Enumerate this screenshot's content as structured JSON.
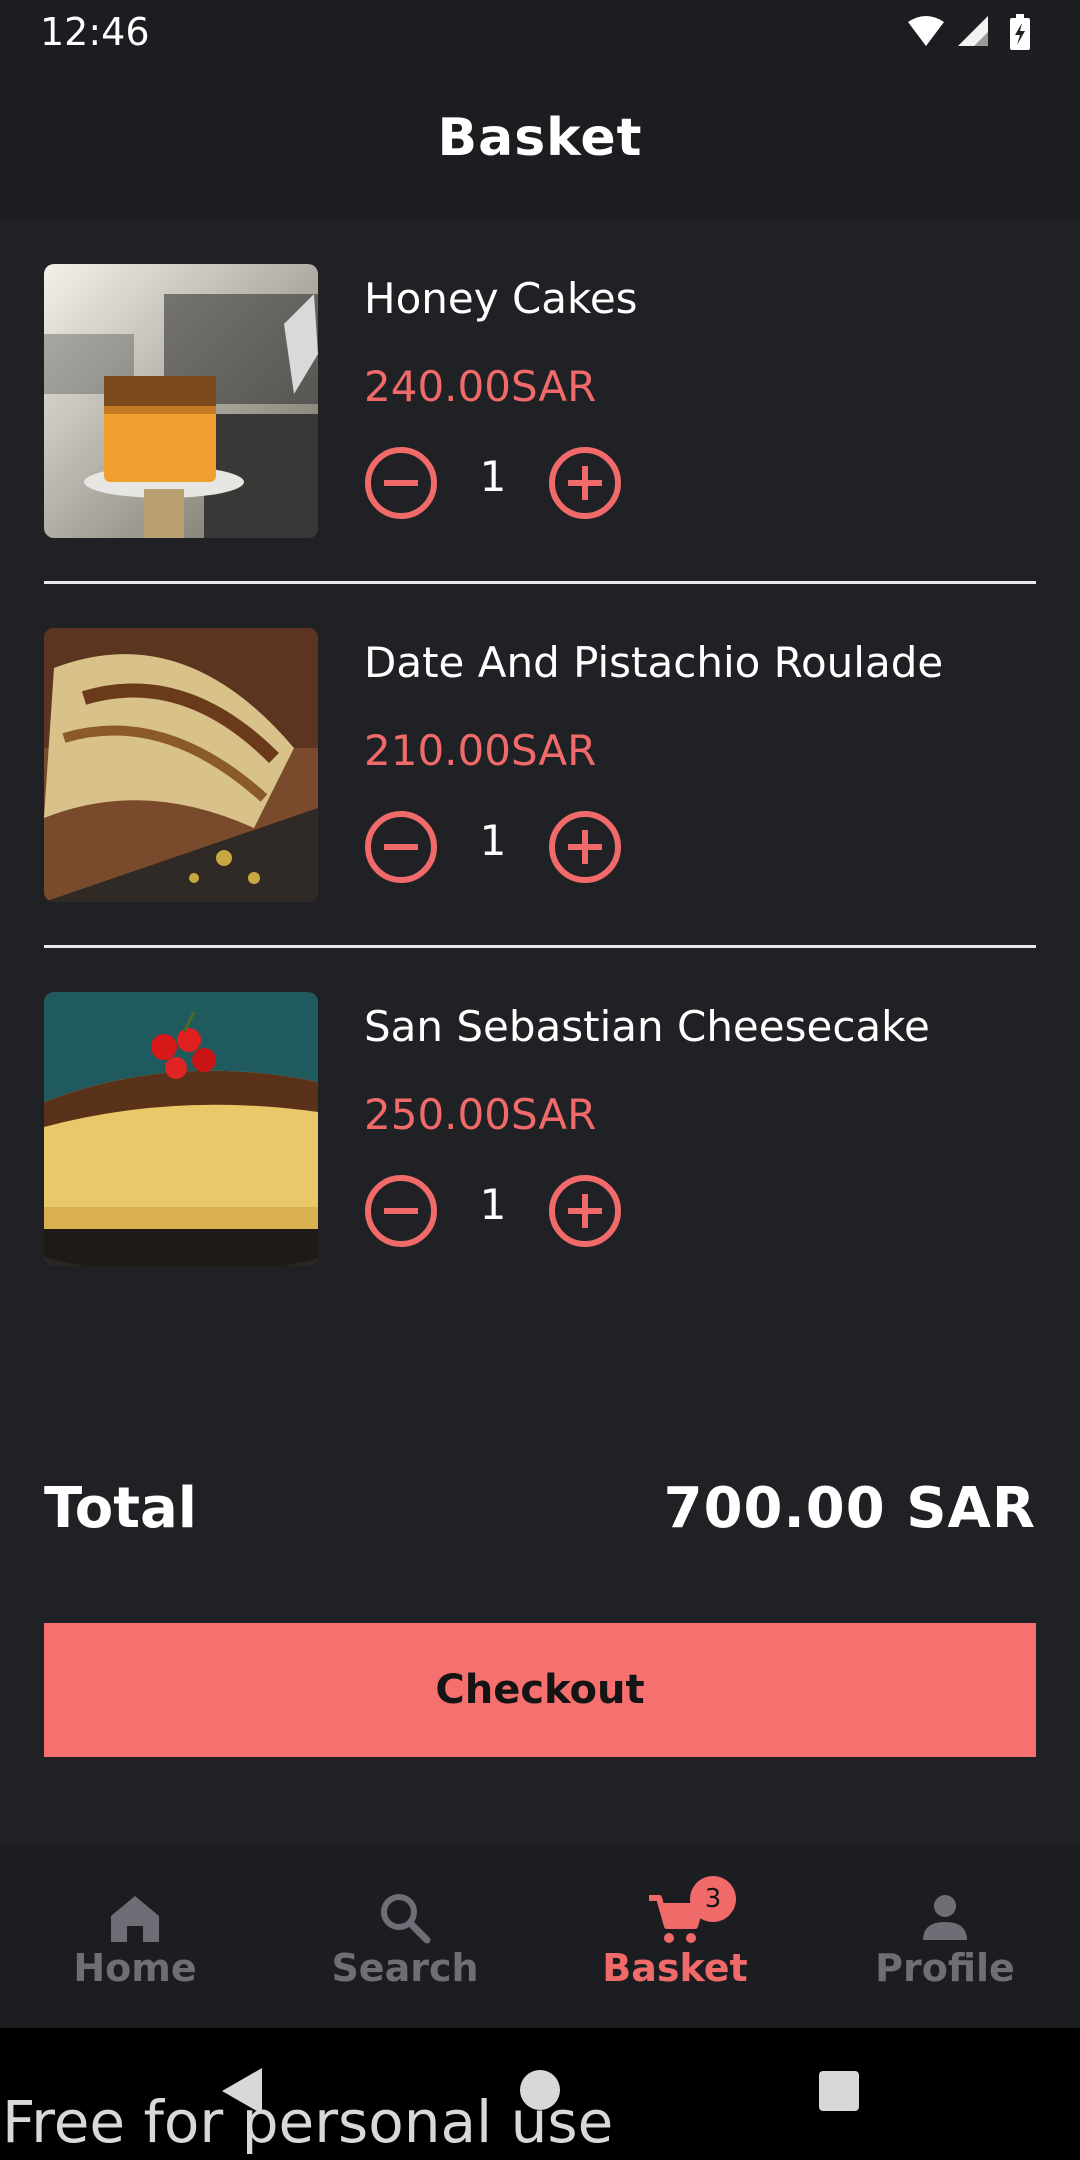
{
  "status_bar": {
    "time": "12:46"
  },
  "header": {
    "title": "Basket"
  },
  "basket": {
    "items": [
      {
        "name": "Honey Cakes",
        "price": "240.00SAR",
        "quantity": "1"
      },
      {
        "name": "Date And Pistachio Roulade",
        "price": "210.00SAR",
        "quantity": "1"
      },
      {
        "name": "San Sebastian Cheesecake",
        "price": "250.00SAR",
        "quantity": "1"
      }
    ],
    "total_label": "Total",
    "total_value": "700.00 SAR",
    "checkout_label": "Checkout"
  },
  "bottom_nav": {
    "items": [
      {
        "label": "Home",
        "icon": "home-icon"
      },
      {
        "label": "Search",
        "icon": "search-icon"
      },
      {
        "label": "Basket",
        "icon": "cart-icon",
        "badge": "3",
        "active": true
      },
      {
        "label": "Profile",
        "icon": "person-icon"
      }
    ]
  },
  "watermark": "Free for personal use",
  "colors": {
    "background": "#202125",
    "bar": "#1c1d21",
    "accent": "#f06a6a",
    "button": "#f77070",
    "inactive": "#6e6f76"
  }
}
